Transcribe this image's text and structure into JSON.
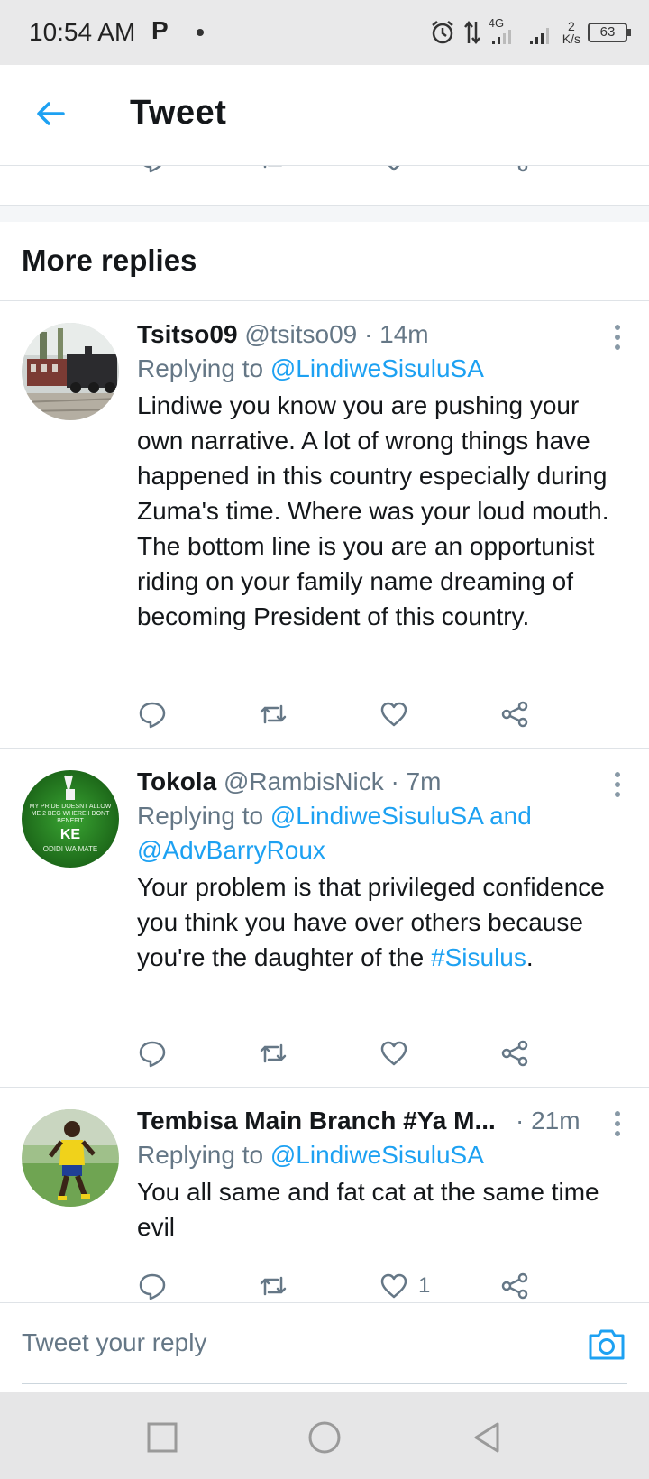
{
  "status_bar": {
    "time": "10:54 AM",
    "notification_letter": "P",
    "network_type": "4G",
    "speed_value": "2",
    "speed_unit": "K/s",
    "battery": "63"
  },
  "header": {
    "title": "Tweet"
  },
  "section": {
    "title": "More replies"
  },
  "tweets": [
    {
      "name": "Tsitso09",
      "handle": "@tsitso09",
      "time": "· 14m",
      "replying_prefix": "Replying to ",
      "replying_to": "@LindiweSisuluSA",
      "paragraph_1": "Lindiwe you know you are pushing your own narrative. A lot of wrong things have happened in this country especially during Zuma's time. Where was your loud mouth.",
      "paragraph_2": "The bottom line is you are an opportunist riding on your family name dreaming of becoming President of this country."
    },
    {
      "name": "Tokola",
      "handle": "@RambisNick",
      "time": "· 7m",
      "replying_prefix": "Replying to ",
      "replying_to": "@LindiweSisuluSA and @AdvBarryRoux",
      "text_before": "Your problem is that privileged confidence you think you have over others because you're the daughter of the ",
      "hashtag": "#Sisulus",
      "text_after": ".",
      "avatar_text_top": "MY PRIDE DOESNT ALLOW ME 2 BEG WHERE I DONT BENEFIT",
      "avatar_text_big": "KE",
      "avatar_text_bottom": "ODIDI WA MATE"
    },
    {
      "name": "Tembisa Main Branch #Ya M...",
      "handle": "",
      "time": "· 21m",
      "replying_prefix": "Replying to ",
      "replying_to": "@LindiweSisuluSA",
      "text": "You all same and fat cat at the same time evil",
      "like_count": "1"
    }
  ],
  "composer": {
    "placeholder": "Tweet your reply"
  },
  "icons": {
    "reply": "reply-icon",
    "retweet": "retweet-icon",
    "like": "like-icon",
    "share": "share-icon",
    "camera": "camera-icon",
    "back": "back-arrow-icon"
  },
  "colors": {
    "accent": "#1da1f2",
    "secondary_text": "#657786",
    "divider": "#dfe3e7"
  }
}
